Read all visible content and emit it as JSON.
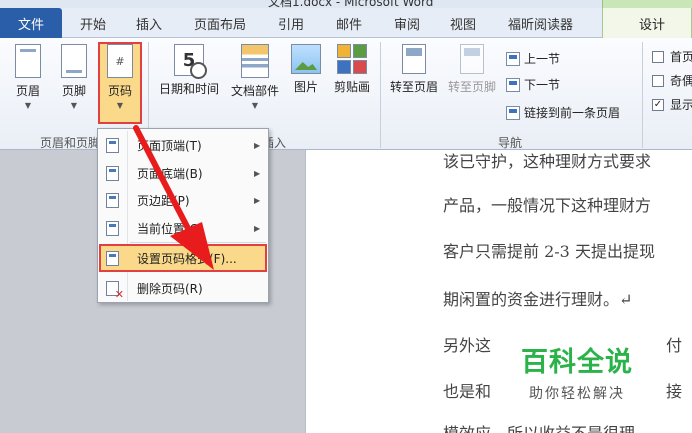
{
  "window": {
    "title": "文档1.docx - Microsoft Word"
  },
  "tabs": {
    "file": "文件",
    "items": [
      "开始",
      "插入",
      "页面布局",
      "引用",
      "邮件",
      "审阅",
      "视图",
      "福昕阅读器"
    ],
    "context": "设计"
  },
  "ribbon": {
    "header_footer_group": {
      "label": "页眉和页脚",
      "header": "页眉",
      "footer": "页脚",
      "page_number": "页码"
    },
    "insert_group": {
      "label": "插入",
      "date_time": "日期和时间",
      "doc_parts": "文档部件",
      "picture": "图片",
      "clip_art": "剪贴画"
    },
    "navigation_group": {
      "label": "导航",
      "goto_header": "转至页眉",
      "goto_footer": "转至页脚",
      "prev": "上一节",
      "next": "下一节",
      "link_prev": "链接到前一条页眉"
    },
    "options": {
      "first_page": "首页",
      "odd_even": "奇偶",
      "show_text": "显示"
    }
  },
  "menu": {
    "top_of_page": "页面顶端(T)",
    "bottom_of_page": "页面底端(B)",
    "page_margins": "页边距(P)",
    "current_position": "当前位置(C)",
    "format_page_numbers": "设置页码格式(F)...",
    "remove_page_numbers": "删除页码(R)"
  },
  "document": {
    "lines": [
      "该已守护，这种理财方式要求",
      "产品，一般情况下这种理财方",
      "客户只需提前 2-3 天提出提现",
      "期闲置的资金进行理财。↵",
      "另外这",
      "也是和",
      "模效应，所以收益不是很理"
    ],
    "frag_right_5": "付",
    "frag_right_6": "接"
  },
  "watermark": {
    "title": "百科全说",
    "subtitle": "助你轻松解决"
  },
  "colors": {
    "file_tab": "#2a5ea9",
    "highlight_fill": "#fbd98a",
    "highlight_border": "#e24040",
    "arrow": "#e81c1c",
    "watermark": "#2bb34a"
  }
}
